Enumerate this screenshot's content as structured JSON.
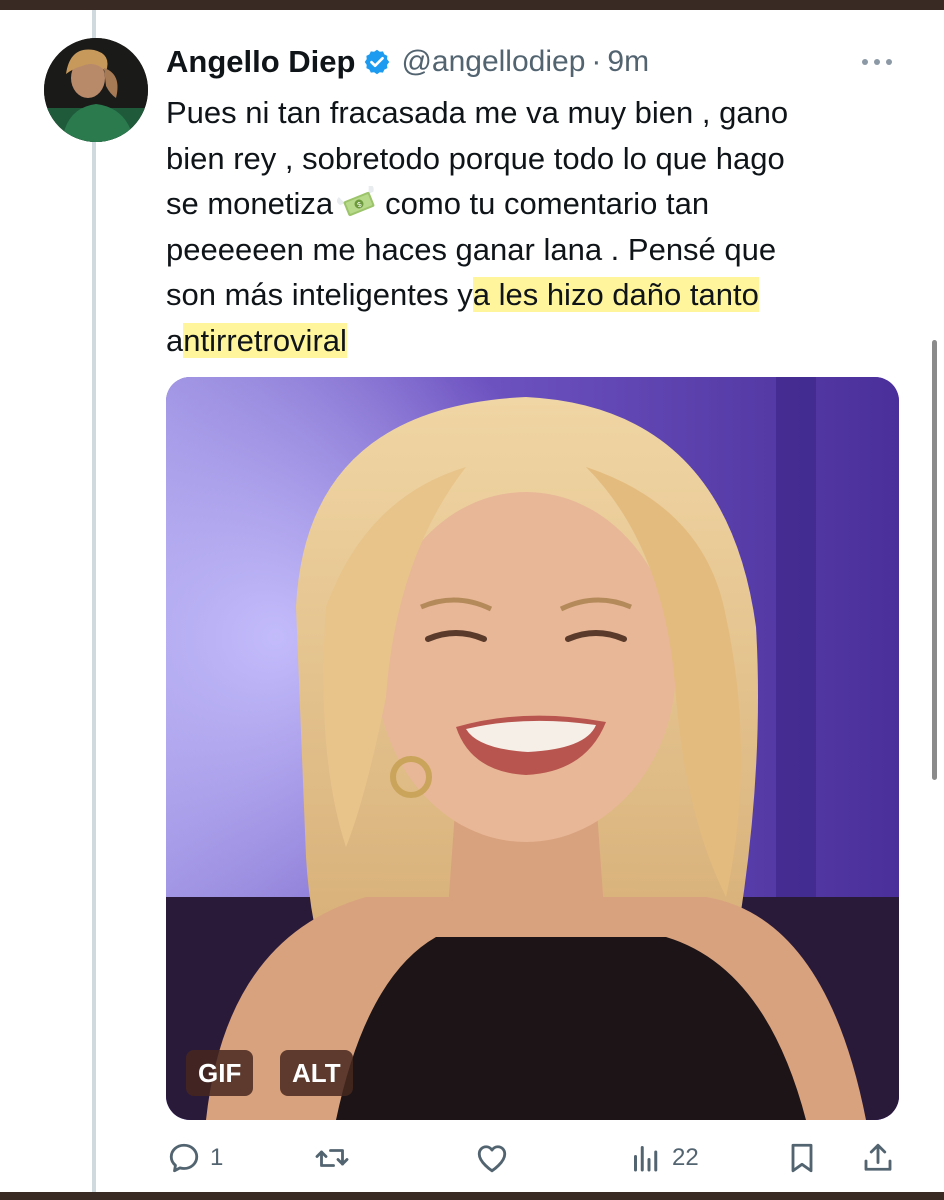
{
  "tweet": {
    "display_name": "Angello Diep",
    "verified": true,
    "handle": "@angellodiep",
    "separator": "·",
    "time": "9m",
    "text": {
      "line1": "Pues ni tan fracasada me va muy bien , gano",
      "line2": "bien rey , sobretodo porque todo lo que hago",
      "line3_before": "se monetiza",
      "line3_after": "como tu comentario tan",
      "line4": "peeeeeen me haces ganar lana . Pensé que",
      "line5_plain": "son más inteligentes y",
      "line5_highlight": "a les hizo daño tanto",
      "line6_plain": "a",
      "line6_highlight": "ntirretroviral"
    },
    "media": {
      "gif_badge": "GIF",
      "alt_badge": "ALT"
    },
    "actions": {
      "reply_count": "1",
      "views_count": "22"
    }
  },
  "icons": {
    "verified": "verified-badge-icon",
    "more": "more-options-icon",
    "money": "money-with-wings-emoji",
    "reply": "reply-icon",
    "retweet": "retweet-icon",
    "like": "heart-icon",
    "views": "views-icon",
    "bookmark": "bookmark-icon",
    "share": "share-icon"
  },
  "colors": {
    "verified_blue": "#1d9bf0",
    "highlight": "#fff59c",
    "text_primary": "#0f1419",
    "text_secondary": "#536471"
  }
}
